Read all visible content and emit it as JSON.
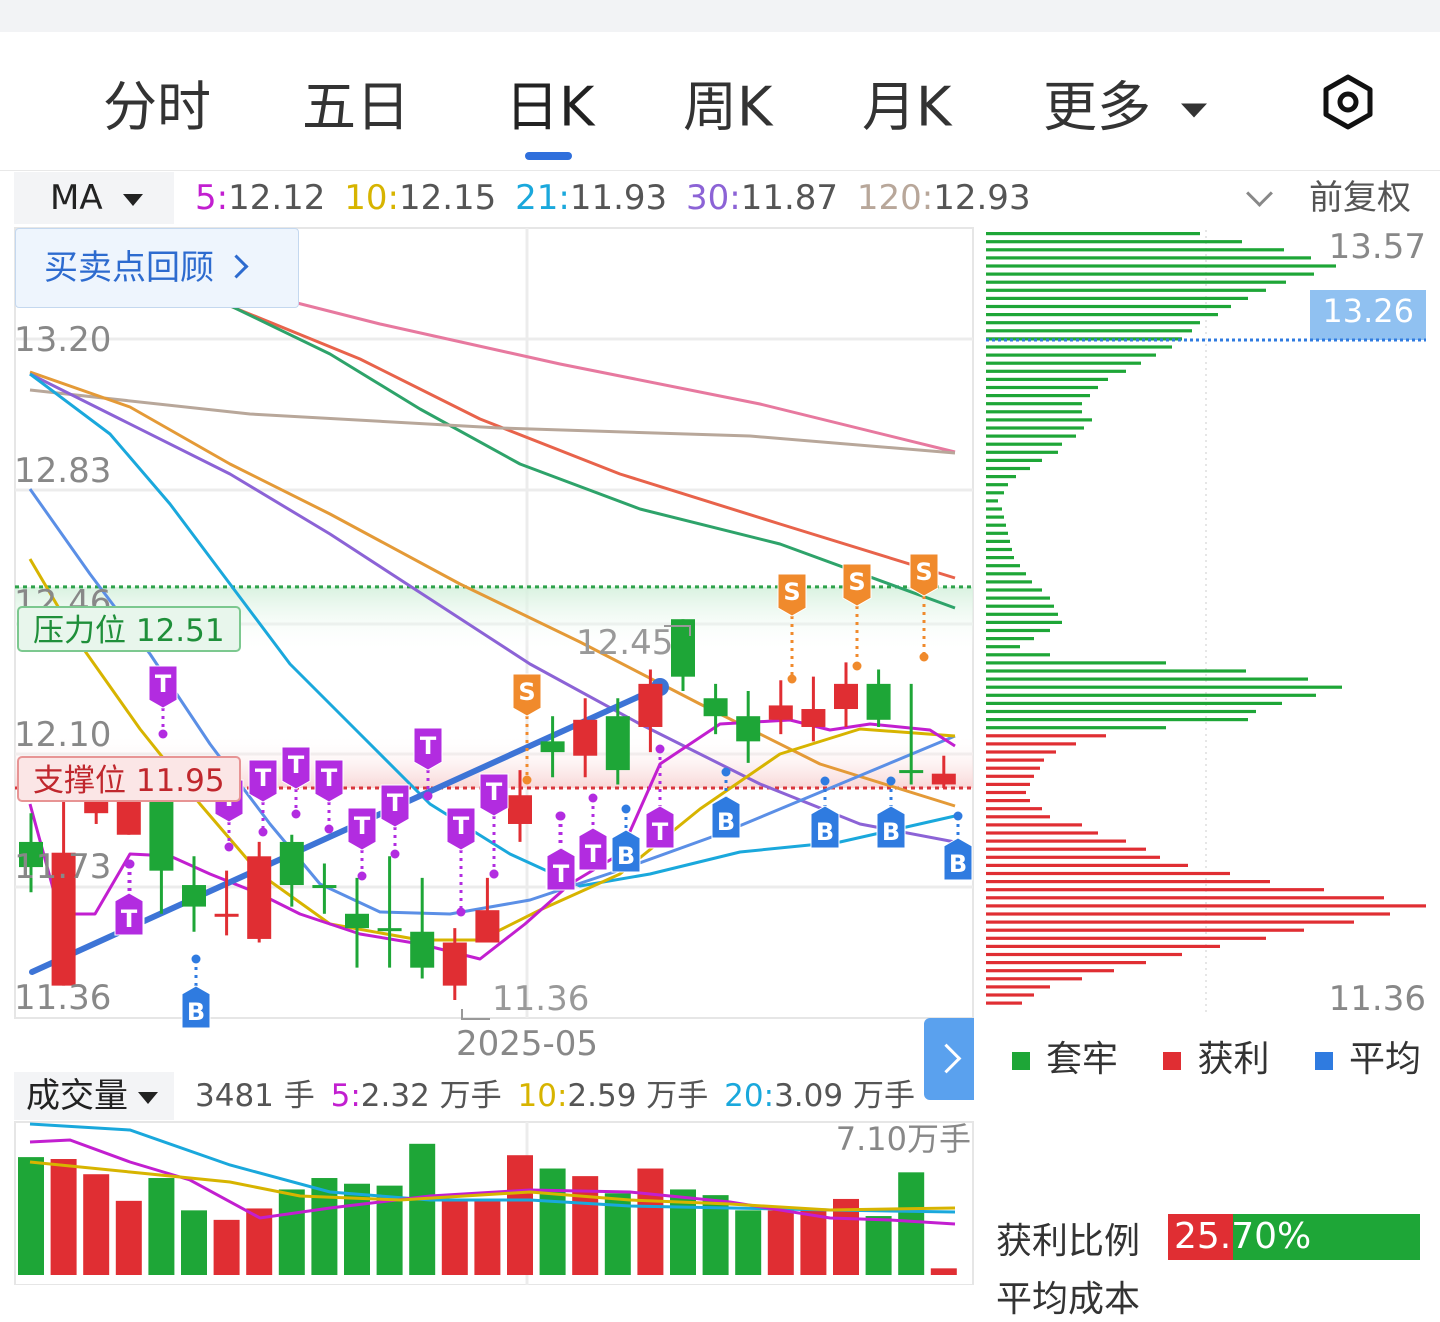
{
  "tabs": [
    {
      "label": "分时"
    },
    {
      "label": "五日"
    },
    {
      "label": "日K",
      "active": true
    },
    {
      "label": "周K"
    },
    {
      "label": "月K"
    },
    {
      "label": "更多"
    }
  ],
  "settings_icon": "settings-hexagon-icon",
  "ma": {
    "selector": "MA",
    "items": [
      {
        "key": "5:",
        "value": "12.12",
        "color": "#c21fd0"
      },
      {
        "key": "10:",
        "value": "12.15",
        "color": "#d7b400"
      },
      {
        "key": "21:",
        "value": "11.93",
        "color": "#1aa8dc"
      },
      {
        "key": "30:",
        "value": "11.87",
        "color": "#8c63d6"
      },
      {
        "key": "120:",
        "value": "12.93",
        "color": "#b8a79a"
      }
    ],
    "adjust": "前复权"
  },
  "review_button": "买卖点回顾",
  "price_axis": [
    "13.20",
    "12.83",
    "12.46",
    "12.10",
    "11.73",
    "11.36"
  ],
  "date_label": "2025-05",
  "pressure": {
    "label": "压力位 12.51",
    "value": 12.51
  },
  "support": {
    "label": "支撑位 11.95",
    "value": 11.95
  },
  "annotations": {
    "high": "12.45",
    "low": "11.36"
  },
  "profile": {
    "top": "13.57",
    "current": "13.26",
    "bottom": "11.36"
  },
  "legend": [
    {
      "label": "套牢",
      "color": "#1ea637"
    },
    {
      "label": "获利",
      "color": "#e02e33"
    },
    {
      "label": "平均",
      "color": "#2f7be0"
    }
  ],
  "volume": {
    "selector": "成交量",
    "current": "3481 手",
    "items": [
      {
        "key": "5:",
        "value": "2.32 万手",
        "color": "#c21fd0"
      },
      {
        "key": "10:",
        "value": "2.59 万手",
        "color": "#d7b400"
      },
      {
        "key": "20:",
        "value": "3.09 万手",
        "color": "#1aa8dc"
      }
    ],
    "max_label": "7.10万手"
  },
  "profit_ratio": {
    "label": "获利比例",
    "value_text": "25.70%",
    "value": 0.257
  },
  "bottom_cut_label": "平均成本",
  "chart_data": {
    "type": "candlestick",
    "y_range": [
      11.36,
      13.57
    ],
    "candles": [
      {
        "o": 11.8,
        "h": 11.88,
        "l": 11.66,
        "c": 11.73,
        "trend": "down"
      },
      {
        "o": 11.77,
        "h": 11.95,
        "l": 11.4,
        "c": 11.4,
        "trend": "up"
      },
      {
        "o": 11.95,
        "h": 12.0,
        "l": 11.85,
        "c": 11.88,
        "trend": "up"
      },
      {
        "o": 11.92,
        "h": 12.0,
        "l": 11.82,
        "c": 11.82,
        "trend": "up"
      },
      {
        "o": 11.72,
        "h": 11.98,
        "l": 11.6,
        "c": 11.95,
        "trend": "down"
      },
      {
        "o": 11.68,
        "h": 11.76,
        "l": 11.55,
        "c": 11.62,
        "trend": "down"
      },
      {
        "o": 11.6,
        "h": 11.72,
        "l": 11.54,
        "c": 11.6,
        "trend": "up"
      },
      {
        "o": 11.53,
        "h": 11.8,
        "l": 11.52,
        "c": 11.76,
        "trend": "up"
      },
      {
        "o": 11.68,
        "h": 11.82,
        "l": 11.62,
        "c": 11.8,
        "trend": "down"
      },
      {
        "o": 11.68,
        "h": 11.74,
        "l": 11.6,
        "c": 11.68,
        "trend": "down"
      },
      {
        "o": 11.6,
        "h": 11.7,
        "l": 11.45,
        "c": 11.56,
        "trend": "down"
      },
      {
        "o": 11.56,
        "h": 11.76,
        "l": 11.45,
        "c": 11.56,
        "trend": "down"
      },
      {
        "o": 11.45,
        "h": 11.7,
        "l": 11.42,
        "c": 11.55,
        "trend": "down"
      },
      {
        "o": 11.52,
        "h": 11.56,
        "l": 11.36,
        "c": 11.4,
        "trend": "up"
      },
      {
        "o": 11.61,
        "h": 11.7,
        "l": 11.52,
        "c": 11.52,
        "trend": "up"
      },
      {
        "o": 11.93,
        "h": 12.0,
        "l": 11.8,
        "c": 11.85,
        "trend": "up"
      },
      {
        "o": 12.08,
        "h": 12.15,
        "l": 11.98,
        "c": 12.05,
        "trend": "down"
      },
      {
        "o": 12.14,
        "h": 12.2,
        "l": 11.98,
        "c": 12.04,
        "trend": "up"
      },
      {
        "o": 12.0,
        "h": 12.2,
        "l": 11.96,
        "c": 12.15,
        "trend": "down"
      },
      {
        "o": 12.24,
        "h": 12.28,
        "l": 12.05,
        "c": 12.12,
        "trend": "up"
      },
      {
        "o": 12.26,
        "h": 12.42,
        "l": 12.22,
        "c": 12.42,
        "trend": "down"
      },
      {
        "o": 12.2,
        "h": 12.24,
        "l": 12.1,
        "c": 12.15,
        "trend": "down"
      },
      {
        "o": 12.15,
        "h": 12.22,
        "l": 12.02,
        "c": 12.08,
        "trend": "down"
      },
      {
        "o": 12.18,
        "h": 12.25,
        "l": 12.1,
        "c": 12.14,
        "trend": "up"
      },
      {
        "o": 12.17,
        "h": 12.26,
        "l": 12.08,
        "c": 12.12,
        "trend": "up"
      },
      {
        "o": 12.24,
        "h": 12.3,
        "l": 12.12,
        "c": 12.17,
        "trend": "up"
      },
      {
        "o": 12.24,
        "h": 12.28,
        "l": 12.12,
        "c": 12.14,
        "trend": "down"
      },
      {
        "o": 12.0,
        "h": 12.24,
        "l": 11.96,
        "c": 12.0,
        "trend": "down"
      },
      {
        "o": 11.99,
        "h": 12.04,
        "l": 11.95,
        "c": 11.96,
        "trend": "up"
      }
    ],
    "markers": [
      {
        "type": "B",
        "count": 5
      },
      {
        "type": "S",
        "count": 4
      },
      {
        "type": "T",
        "count": 17
      }
    ],
    "volume_bars": [
      {
        "v": 6.2,
        "trend": "down"
      },
      {
        "v": 6.1,
        "trend": "up"
      },
      {
        "v": 5.3,
        "trend": "up"
      },
      {
        "v": 3.9,
        "trend": "up"
      },
      {
        "v": 5.1,
        "trend": "down"
      },
      {
        "v": 3.4,
        "trend": "down"
      },
      {
        "v": 2.9,
        "trend": "up"
      },
      {
        "v": 3.5,
        "trend": "up"
      },
      {
        "v": 4.5,
        "trend": "down"
      },
      {
        "v": 5.1,
        "trend": "down"
      },
      {
        "v": 4.8,
        "trend": "down"
      },
      {
        "v": 4.7,
        "trend": "down"
      },
      {
        "v": 6.9,
        "trend": "down"
      },
      {
        "v": 3.9,
        "trend": "up"
      },
      {
        "v": 3.9,
        "trend": "up"
      },
      {
        "v": 6.3,
        "trend": "up"
      },
      {
        "v": 5.6,
        "trend": "down"
      },
      {
        "v": 5.2,
        "trend": "up"
      },
      {
        "v": 4.3,
        "trend": "down"
      },
      {
        "v": 5.6,
        "trend": "up"
      },
      {
        "v": 4.5,
        "trend": "down"
      },
      {
        "v": 4.2,
        "trend": "down"
      },
      {
        "v": 3.4,
        "trend": "down"
      },
      {
        "v": 3.4,
        "trend": "up"
      },
      {
        "v": 3.5,
        "trend": "up"
      },
      {
        "v": 4.0,
        "trend": "up"
      },
      {
        "v": 3.1,
        "trend": "down"
      },
      {
        "v": 5.4,
        "trend": "down"
      },
      {
        "v": 0.35,
        "trend": "up"
      }
    ]
  }
}
